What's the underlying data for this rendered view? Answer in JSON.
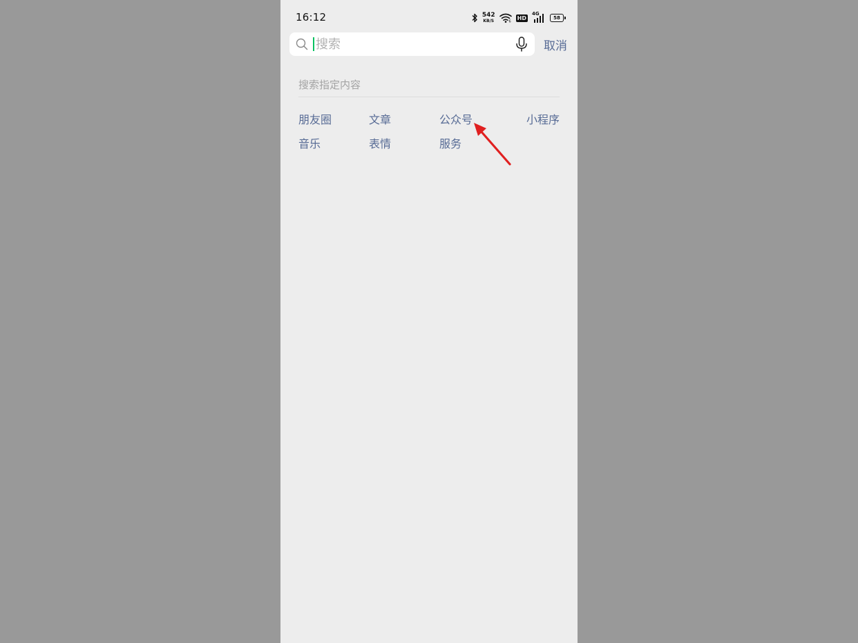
{
  "status_bar": {
    "time": "16:12",
    "net_speed_value": "542",
    "net_speed_unit": "KB/S",
    "hd_label": "HD",
    "network_type": "4G",
    "battery_level": "58"
  },
  "search": {
    "placeholder": "搜索",
    "value": "",
    "cancel_label": "取消"
  },
  "section": {
    "title": "搜索指定内容",
    "categories": [
      "朋友圈",
      "文章",
      "公众号",
      "小程序",
      "音乐",
      "表情",
      "服务"
    ]
  },
  "colors": {
    "link": "#576b95",
    "background": "#ededed",
    "cursor": "#07c160",
    "annotation": "#e02020"
  },
  "icons": {
    "search": "search-icon",
    "microphone": "microphone-icon",
    "bluetooth": "bluetooth-icon",
    "wifi": "wifi-icon",
    "signal": "signal-icon",
    "battery": "battery-icon",
    "annotation": "red-arrow-icon"
  }
}
